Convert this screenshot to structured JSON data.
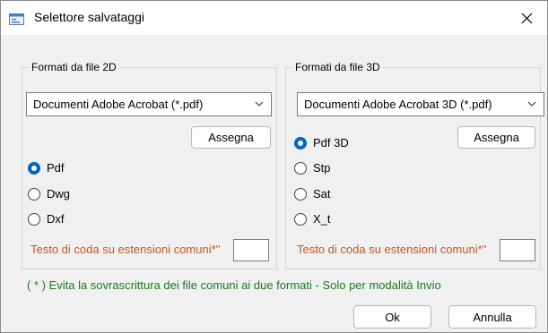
{
  "window": {
    "title": "Selettore salvataggi",
    "icon": "dialog-app-icon",
    "close_glyph": "✕"
  },
  "group2d": {
    "label": "Formati da file 2D",
    "combo_value": "Documenti Adobe Acrobat (*.pdf)",
    "assign_label": "Assegna",
    "options": [
      {
        "label": "Pdf",
        "checked": true
      },
      {
        "label": "Dwg",
        "checked": false
      },
      {
        "label": "Dxf",
        "checked": false
      }
    ],
    "suffix_label": "Testo di coda su estensioni comuni*''",
    "suffix_value": ""
  },
  "group3d": {
    "label": "Formati da file 3D",
    "combo_value": "Documenti Adobe Acrobat 3D (*.pdf)",
    "assign_label": "Assegna",
    "options": [
      {
        "label": "Pdf 3D",
        "checked": true
      },
      {
        "label": "Stp",
        "checked": false
      },
      {
        "label": "Sat",
        "checked": false
      },
      {
        "label": "X_t",
        "checked": false
      }
    ],
    "suffix_label": "Testo di coda su estensioni comuni*''",
    "suffix_value": ""
  },
  "note": "( * ) Evita la sovrascrittura dei file comuni ai due formati - Solo per modalità Invio",
  "buttons": {
    "ok": "Ok",
    "cancel": "Annulla"
  },
  "colors": {
    "accent": "#0067c0",
    "warning_text": "#c8561e",
    "note_text": "#1d7a1d"
  }
}
